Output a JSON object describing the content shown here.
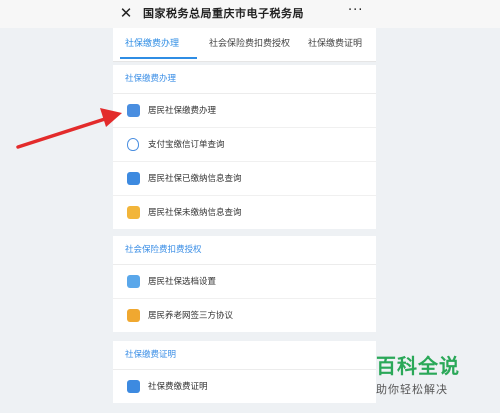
{
  "header": {
    "close_glyph": "✕",
    "title": "国家税务总局重庆市电子税务局",
    "more_glyph": "···"
  },
  "tabs": [
    {
      "label": "社保缴费办理",
      "active": true
    },
    {
      "label": "社会保险费扣费授权",
      "active": false
    },
    {
      "label": "社保缴费证明",
      "active": false
    }
  ],
  "sections": [
    {
      "header": "社保缴费办理",
      "items": [
        {
          "label": "居民社保缴费办理",
          "icon": "person-pay-icon"
        },
        {
          "label": "支付宝缴信订单查询",
          "icon": "shield-icon"
        },
        {
          "label": "居民社保已缴纳信息查询",
          "icon": "document-icon"
        },
        {
          "label": "居民社保未缴纳信息查询",
          "icon": "card-icon"
        }
      ]
    },
    {
      "header": "社会保险费扣费授权",
      "items": [
        {
          "label": "居民社保选档设置",
          "icon": "settings-card-icon"
        },
        {
          "label": "居民养老网签三方协议",
          "icon": "sign-icon"
        }
      ]
    },
    {
      "header": "社保缴费证明",
      "items": [
        {
          "label": "社保费缴费证明",
          "icon": "document-icon"
        }
      ]
    }
  ],
  "watermark": {
    "main": "百科全说",
    "sub": "助你轻松解决"
  },
  "colors": {
    "accent": "#2f8de4",
    "arrow": "#e32b2b",
    "watermark": "#2aa858"
  }
}
